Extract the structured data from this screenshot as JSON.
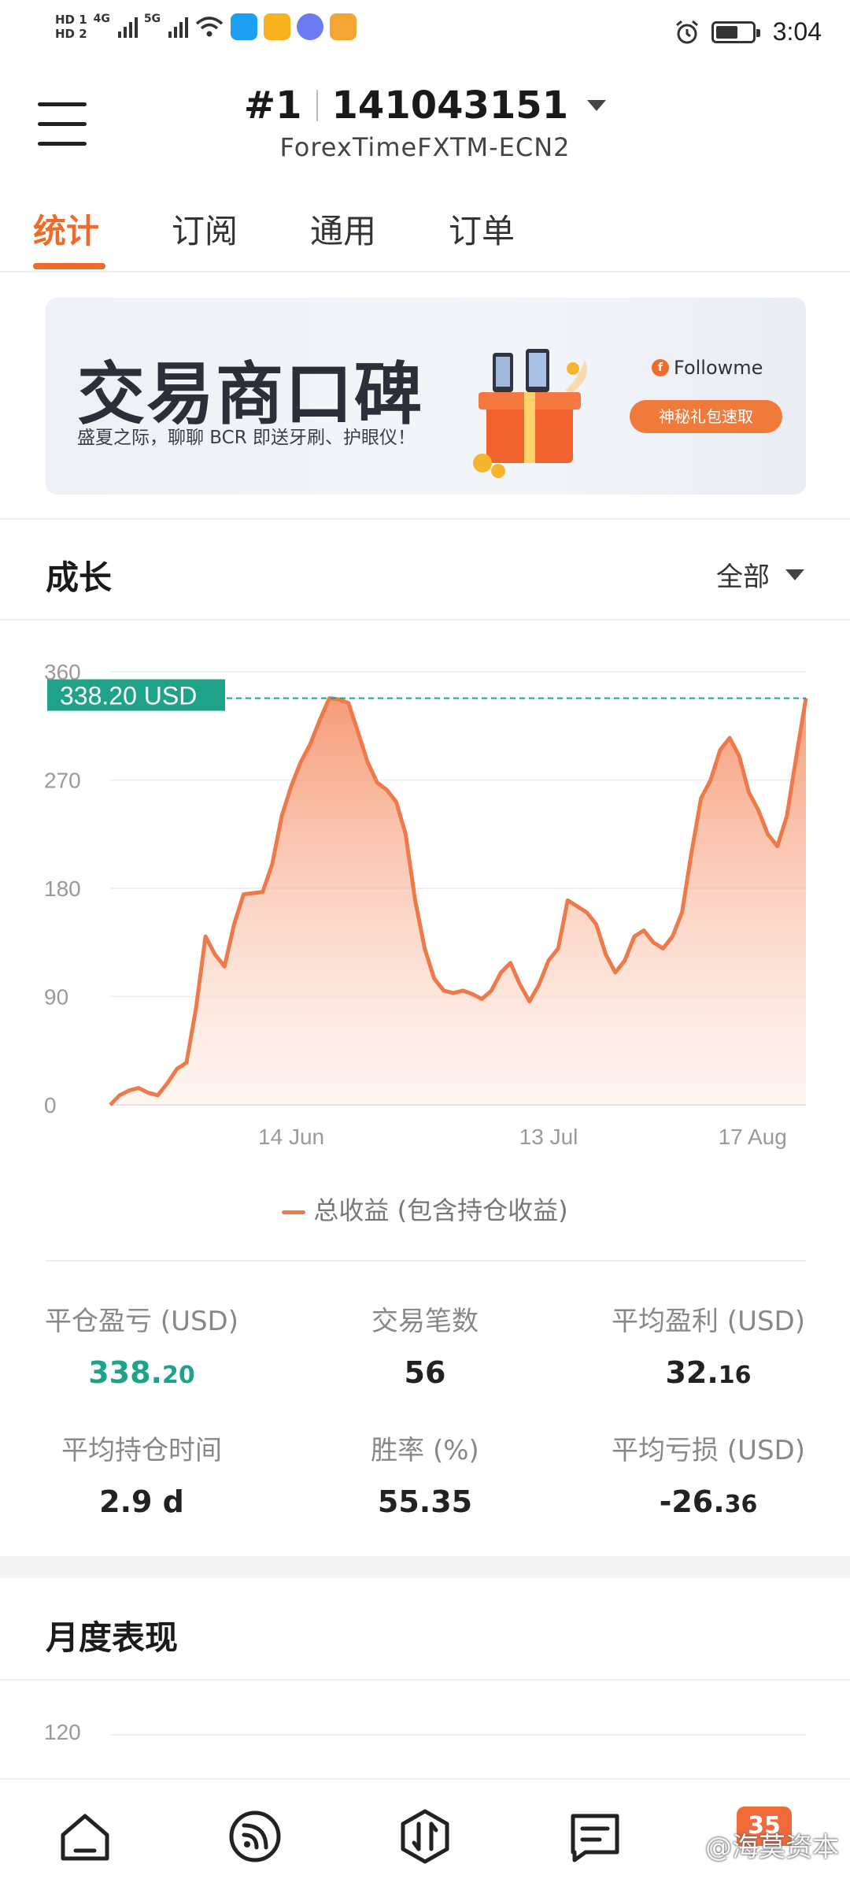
{
  "status_bar": {
    "hd1": "HD 1",
    "hd2": "HD 2",
    "net1": "4G",
    "net2": "5G",
    "time": "3:04",
    "icons": [
      "wifi-icon",
      "qq-browser-icon",
      "mail-icon",
      "music-icon",
      "note-icon",
      "alarm-icon",
      "battery-icon"
    ]
  },
  "header": {
    "account_index": "#1",
    "account_number": "141043151",
    "broker": "ForexTimeFXTM-ECN2"
  },
  "tabs": [
    {
      "label": "统计",
      "active": true
    },
    {
      "label": "订阅",
      "active": false
    },
    {
      "label": "通用",
      "active": false
    },
    {
      "label": "订单",
      "active": false
    }
  ],
  "banner": {
    "title": "交易商口碑",
    "subtitle": "盛夏之际，聊聊 BCR 即送牙刷、护眼仪！",
    "brand": "Followme",
    "cta": "神秘礼包速取"
  },
  "growth": {
    "title": "成长",
    "filter": "全部",
    "current_label": "338.20 USD",
    "legend": "总收益 (包含持仓收益)"
  },
  "chart_data": {
    "type": "area",
    "x": [
      "",
      "",
      "",
      "",
      "",
      "",
      "",
      "",
      "",
      "",
      "",
      "",
      "",
      "",
      "",
      "",
      "",
      "",
      "",
      "",
      "",
      "",
      "",
      "",
      "",
      "",
      "",
      "",
      "",
      "",
      "",
      "",
      "",
      "",
      "",
      "",
      "",
      "",
      "",
      "",
      "",
      "",
      "",
      "",
      "",
      "",
      "",
      "",
      "",
      "",
      "",
      "",
      "",
      "",
      "",
      "",
      "",
      "",
      "",
      "",
      "",
      "",
      "",
      "",
      "",
      "",
      "",
      "",
      "",
      "",
      "",
      "",
      "",
      ""
    ],
    "values": [
      0,
      8,
      12,
      14,
      10,
      8,
      18,
      30,
      35,
      80,
      140,
      125,
      115,
      150,
      175,
      176,
      177,
      200,
      240,
      265,
      285,
      300,
      320,
      338,
      337,
      334,
      310,
      285,
      268,
      262,
      252,
      225,
      170,
      130,
      105,
      95,
      93,
      95,
      92,
      88,
      95,
      110,
      118,
      100,
      86,
      100,
      120,
      130,
      170,
      165,
      160,
      150,
      125,
      110,
      120,
      140,
      145,
      135,
      130,
      140,
      160,
      210,
      255,
      270,
      295,
      305,
      290,
      260,
      245,
      225,
      215,
      240,
      290,
      338
    ],
    "x_ticks": [
      "14 Jun",
      "13 Jul",
      "17 Aug"
    ],
    "y_ticks": [
      0,
      90,
      180,
      270,
      360
    ],
    "ylim": [
      0,
      360
    ],
    "series_name": "总收益 (包含持仓收益)",
    "last_value_label": "338.20 USD",
    "line_color": "#ee7a4a",
    "marker_color": "#1ea38a",
    "grid": true,
    "legend_position": "bottom"
  },
  "stats": [
    {
      "label": "平仓盈亏 (USD)",
      "value_main": "338.",
      "value_minor": "20",
      "color": "#1ea38a"
    },
    {
      "label": "交易笔数",
      "value_main": "56",
      "value_minor": ""
    },
    {
      "label": "平均盈利 (USD)",
      "value_main": "32.",
      "value_minor": "16"
    },
    {
      "label": "平均持仓时间",
      "value_main": "2.9 d",
      "value_minor": ""
    },
    {
      "label": "胜率 (%)",
      "value_main": "55.35",
      "value_minor": ""
    },
    {
      "label": "平均亏损 (USD)",
      "value_main": "-26.",
      "value_minor": "36"
    }
  ],
  "monthly": {
    "title": "月度表现",
    "y_top_tick": "120"
  },
  "bottom_nav": {
    "items": [
      "home-icon",
      "feed-icon",
      "trade-icon",
      "message-icon"
    ],
    "badge": "35",
    "watermark": "@海莫资本"
  }
}
